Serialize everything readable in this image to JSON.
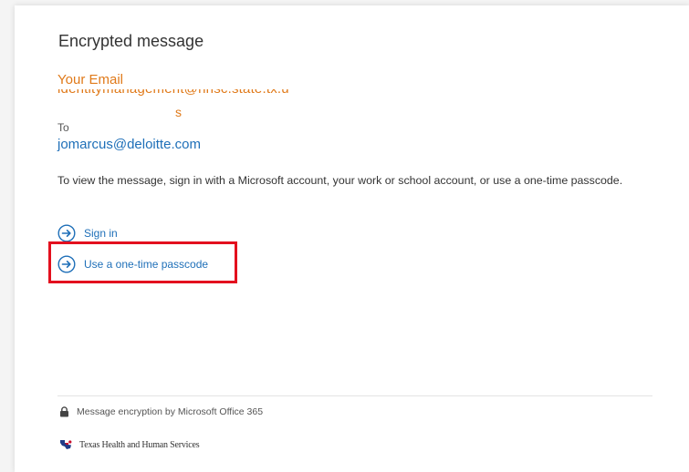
{
  "message": {
    "title": "Encrypted message",
    "your_email_label": "Your Email",
    "from_address": "identitymanagement@hhsc.state.tx.u",
    "from_address_suffix": "s",
    "to_label": "To",
    "to_address": "jomarcus@deloitte.com",
    "instructions": "To view the message, sign in with a Microsoft account, your work or school account, or use a one-time passcode."
  },
  "actions": {
    "sign_in_label": "Sign in",
    "otp_label": "Use a one-time passcode"
  },
  "footer": {
    "encryption_label": "Message encryption by Microsoft Office 365",
    "organization_label": "Texas Health and Human Services"
  },
  "colors": {
    "link": "#1e6fb8",
    "annotation": "#e07a1a",
    "highlight": "#e3101e"
  }
}
